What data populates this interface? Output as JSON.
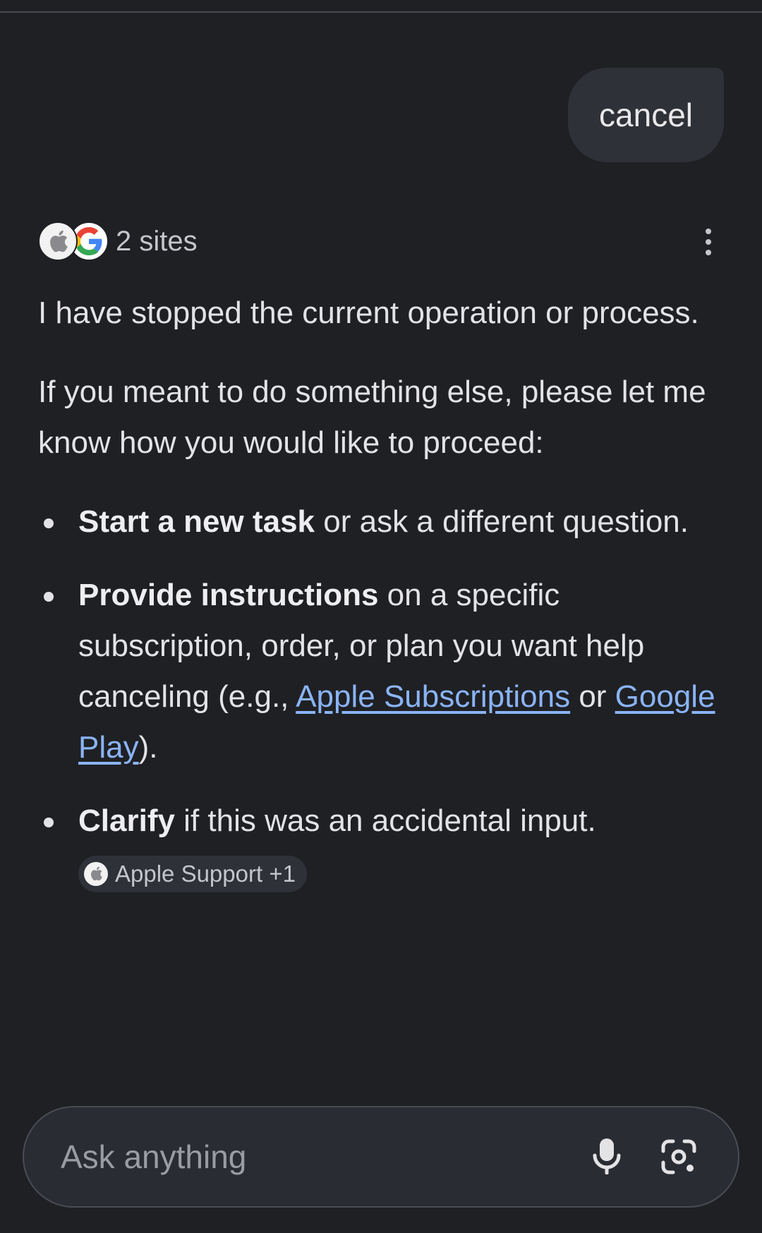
{
  "user_message": "cancel",
  "sources": {
    "count_label": "2 sites",
    "icons": [
      "apple-icon",
      "google-icon"
    ]
  },
  "answer": {
    "paragraph1": "I have stopped the current operation or process.",
    "paragraph2": "If you meant to do something else, please let me know how you would like to proceed:",
    "bullets": [
      {
        "bold": "Start a new task",
        "rest": " or ask a different question."
      },
      {
        "bold": "Provide instructions",
        "rest": " on a specific subscription, order, or plan you want help canceling (e.g., ",
        "link1": "Apple Subscriptions",
        "mid": " or ",
        "link2": "Google Play",
        "end": ")."
      },
      {
        "bold": "Clarify",
        "rest": " if this was an accidental input."
      }
    ],
    "citation_chip": "Apple Support +1"
  },
  "input": {
    "placeholder": "Ask anything"
  },
  "colors": {
    "background": "#1f2024",
    "bubble": "#2f3138",
    "link": "#8ab4f8",
    "text": "#e3e3e6"
  }
}
